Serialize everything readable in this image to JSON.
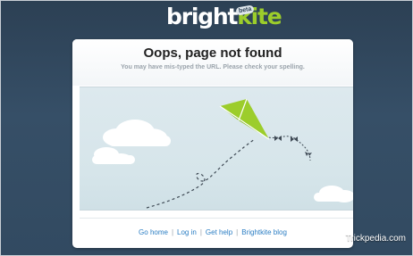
{
  "brand": {
    "name_part1": "bright",
    "name_part2": "kite",
    "beta_label": "beta"
  },
  "error": {
    "title": "Oops, page not found",
    "message": "You may have mis-typed the URL. Please check your spelling."
  },
  "footer_links": {
    "go_home": "Go home",
    "log_in": "Log in",
    "get_help": "Get help",
    "blog": "Brightkite blog",
    "separator": "|"
  },
  "watermark": "Trickpedia.com",
  "colors": {
    "background": "#324a61",
    "brand_green": "#9ccd2b",
    "link_blue": "#2a7dc3",
    "kite_green": "#9ccd2b"
  }
}
